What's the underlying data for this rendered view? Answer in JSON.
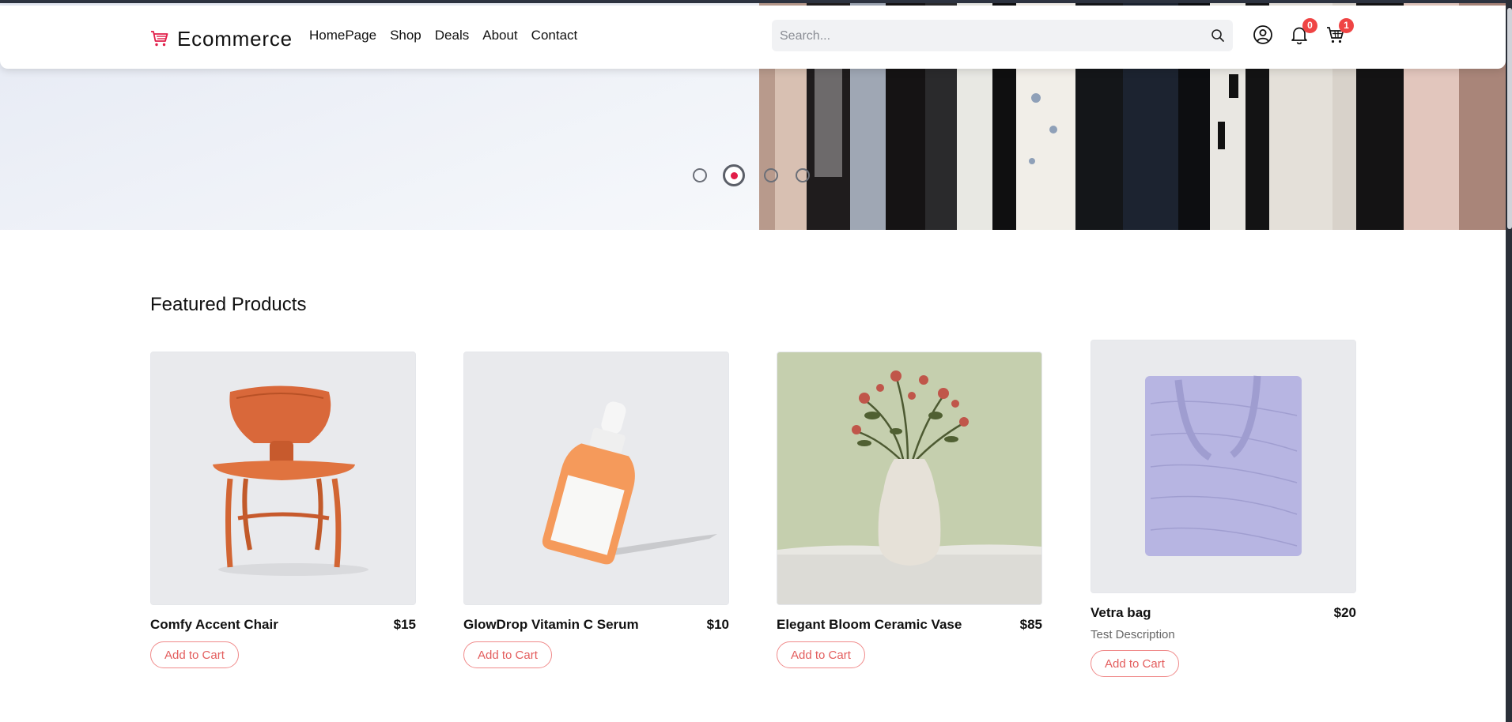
{
  "header": {
    "brand": "Ecommerce",
    "nav": [
      "HomePage",
      "Shop",
      "Deals",
      "About",
      "Contact"
    ],
    "search_placeholder": "Search...",
    "notifications_count": "0",
    "cart_count": "1",
    "icons": [
      "cart-logo-icon",
      "search-icon",
      "user-icon",
      "bell-icon",
      "cart-icon"
    ]
  },
  "hero": {
    "slides": 4,
    "active_slide": 2
  },
  "featured": {
    "title": "Featured Products",
    "products": [
      {
        "name": "Comfy Accent Chair",
        "price": "$15",
        "description": "",
        "button": "Add to Cart"
      },
      {
        "name": "GlowDrop Vitamin C Serum",
        "price": "$10",
        "description": "",
        "button": "Add to Cart"
      },
      {
        "name": "Elegant Bloom Ceramic Vase",
        "price": "$85",
        "description": "",
        "button": "Add to Cart"
      },
      {
        "name": "Vetra bag",
        "price": "$20",
        "description": "Test Description",
        "button": "Add to Cart"
      }
    ]
  },
  "colors": {
    "accent": "#e11d48",
    "badge": "#ef4444",
    "button_border": "#f08a8a",
    "button_text": "#e35d5d"
  }
}
